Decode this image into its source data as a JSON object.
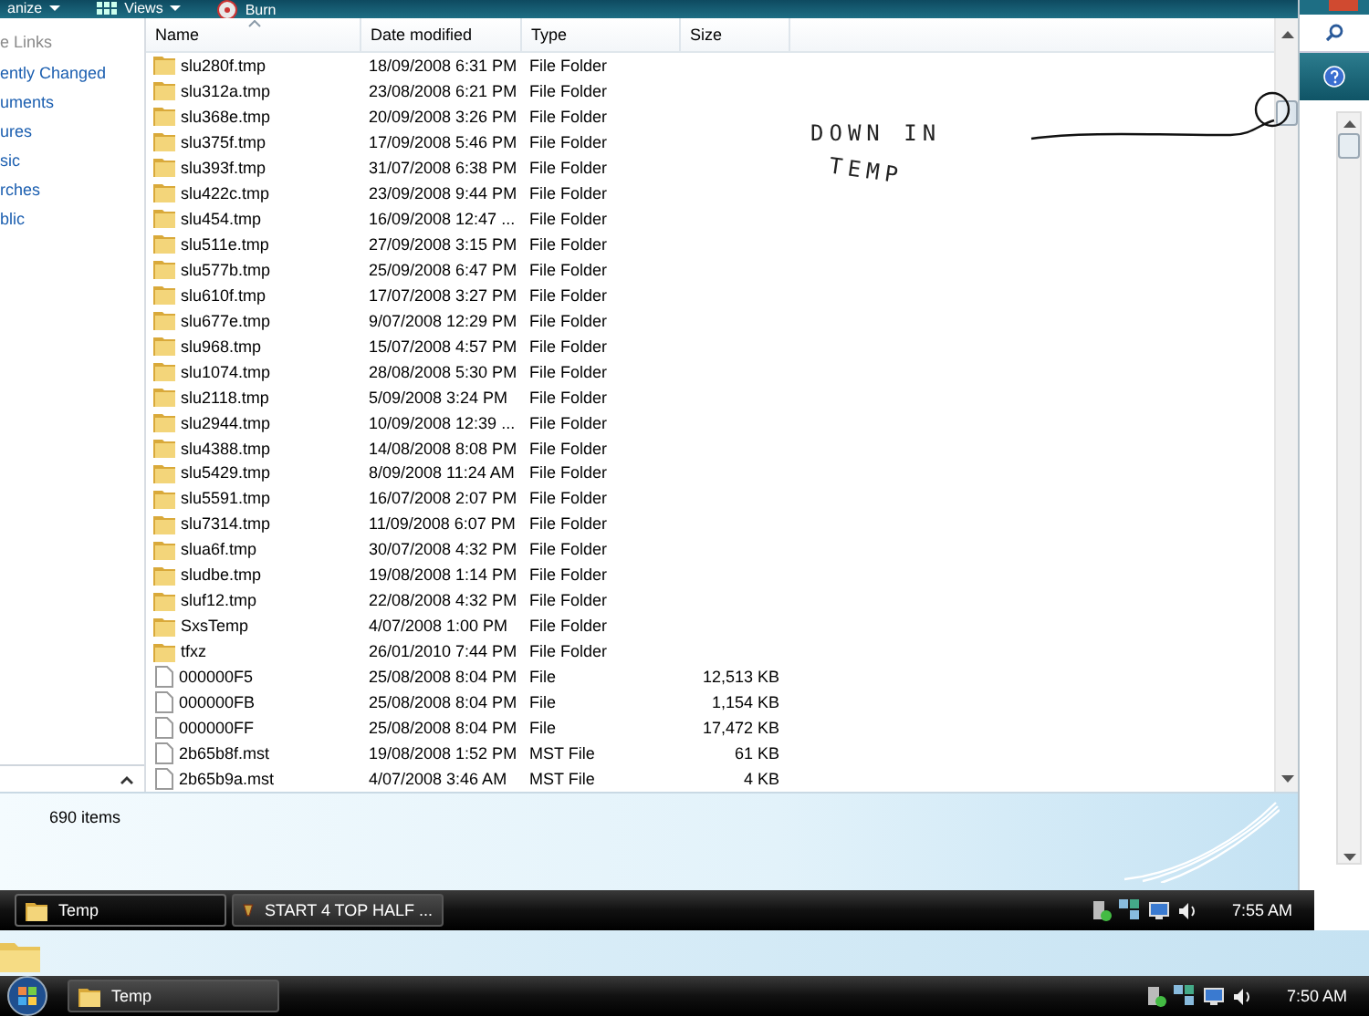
{
  "toolbar": {
    "buttons": [
      {
        "label": "anize",
        "dropdown": true
      },
      {
        "label": "Views",
        "dropdown": true
      },
      {
        "label": "Burn",
        "dropdown": false
      }
    ]
  },
  "nav": {
    "heading": "e Links",
    "items": [
      "ently Changed",
      "uments",
      "ures",
      "sic",
      "rches",
      "blic"
    ]
  },
  "table": {
    "columns": [
      "Name",
      "Date modified",
      "Type",
      "Size"
    ],
    "rows": [
      {
        "kind": "folder",
        "name": "slu280f.tmp",
        "date": "18/09/2008 6:31 PM",
        "type": "File Folder"
      },
      {
        "kind": "folder",
        "name": "slu312a.tmp",
        "date": "23/08/2008 6:21 PM",
        "type": "File Folder"
      },
      {
        "kind": "folder",
        "name": "slu368e.tmp",
        "date": "20/09/2008 3:26 PM",
        "type": "File Folder"
      },
      {
        "kind": "folder",
        "name": "slu375f.tmp",
        "date": "17/09/2008 5:46 PM",
        "type": "File Folder"
      },
      {
        "kind": "folder",
        "name": "slu393f.tmp",
        "date": "31/07/2008 6:38 PM",
        "type": "File Folder"
      },
      {
        "kind": "folder",
        "name": "slu422c.tmp",
        "date": "23/09/2008 9:44 PM",
        "type": "File Folder"
      },
      {
        "kind": "folder",
        "name": "slu454.tmp",
        "date": "16/09/2008 12:47 ...",
        "type": "File Folder"
      },
      {
        "kind": "folder",
        "name": "slu511e.tmp",
        "date": "27/09/2008 3:15 PM",
        "type": "File Folder"
      },
      {
        "kind": "folder",
        "name": "slu577b.tmp",
        "date": "25/09/2008 6:47 PM",
        "type": "File Folder"
      },
      {
        "kind": "folder",
        "name": "slu610f.tmp",
        "date": "17/07/2008 3:27 PM",
        "type": "File Folder"
      },
      {
        "kind": "folder",
        "name": "slu677e.tmp",
        "date": "9/07/2008 12:29 PM",
        "type": "File Folder"
      },
      {
        "kind": "folder",
        "name": "slu968.tmp",
        "date": "15/07/2008 4:57 PM",
        "type": "File Folder"
      },
      {
        "kind": "folder",
        "name": "slu1074.tmp",
        "date": "28/08/2008 5:30 PM",
        "type": "File Folder"
      },
      {
        "kind": "folder",
        "name": "slu2118.tmp",
        "date": "5/09/2008 3:24 PM",
        "type": "File Folder"
      },
      {
        "kind": "folder",
        "name": "slu2944.tmp",
        "date": "10/09/2008 12:39 ...",
        "type": "File Folder"
      },
      {
        "kind": "folder",
        "name": "slu4388.tmp",
        "date": "14/08/2008 8:08 PM",
        "type": "File Folder"
      },
      {
        "kind": "folder",
        "name": "slu5429.tmp",
        "date": "8/09/2008 11:24 AM",
        "type": "File Folder"
      },
      {
        "kind": "folder",
        "name": "slu5591.tmp",
        "date": "16/07/2008 2:07 PM",
        "type": "File Folder"
      },
      {
        "kind": "folder",
        "name": "slu7314.tmp",
        "date": "11/09/2008 6:07 PM",
        "type": "File Folder"
      },
      {
        "kind": "folder",
        "name": "slua6f.tmp",
        "date": "30/07/2008 4:32 PM",
        "type": "File Folder"
      },
      {
        "kind": "folder",
        "name": "sludbe.tmp",
        "date": "19/08/2008 1:14 PM",
        "type": "File Folder"
      },
      {
        "kind": "folder",
        "name": "sluf12.tmp",
        "date": "22/08/2008 4:32 PM",
        "type": "File Folder"
      },
      {
        "kind": "folder",
        "name": "SxsTemp",
        "date": "4/07/2008 1:00 PM",
        "type": "File Folder"
      },
      {
        "kind": "folder",
        "name": "tfxz",
        "date": "26/01/2010 7:44 PM",
        "type": "File Folder"
      },
      {
        "kind": "file",
        "name": "000000F5",
        "date": "25/08/2008 8:04 PM",
        "type": "File",
        "size": "12,513 KB"
      },
      {
        "kind": "file",
        "name": "000000FB",
        "date": "25/08/2008 8:04 PM",
        "type": "File",
        "size": "1,154 KB"
      },
      {
        "kind": "file",
        "name": "000000FF",
        "date": "25/08/2008 8:04 PM",
        "type": "File",
        "size": "17,472 KB"
      },
      {
        "kind": "file",
        "name": "2b65b8f.mst",
        "date": "19/08/2008 1:52 PM",
        "type": "MST File",
        "size": "61 KB"
      },
      {
        "kind": "file",
        "name": "2b65b9a.mst",
        "date": "4/07/2008 3:46 AM",
        "type": "MST File",
        "size": "4 KB"
      }
    ]
  },
  "annotation": {
    "lines": [
      "DOWN IN",
      "TEMP"
    ]
  },
  "status_bar": {
    "count": "690 items"
  },
  "taskbars": [
    {
      "start_button": false,
      "items": [
        {
          "label": "Temp",
          "kind": "folder",
          "selected": true
        },
        {
          "label": "START 4 TOP HALF ...",
          "kind": "app",
          "selected": false
        }
      ],
      "clock": "7:55 AM"
    },
    {
      "start_button": true,
      "items": [
        {
          "label": "Temp",
          "kind": "folder",
          "selected": false
        }
      ],
      "clock": "7:50 AM"
    }
  ]
}
